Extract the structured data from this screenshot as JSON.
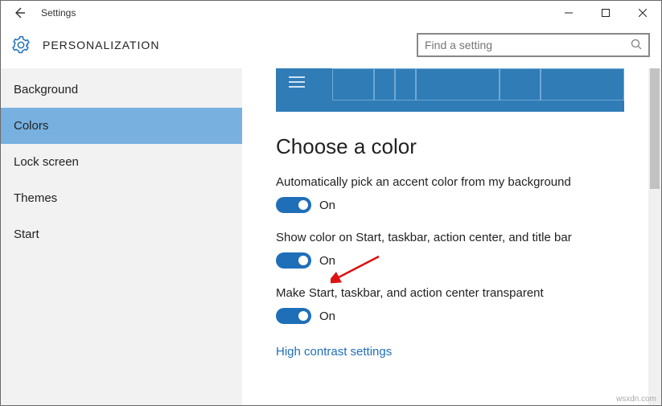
{
  "window": {
    "title": "Settings"
  },
  "header": {
    "title": "PERSONALIZATION",
    "search_placeholder": "Find a setting"
  },
  "sidebar": {
    "items": [
      {
        "label": "Background"
      },
      {
        "label": "Colors"
      },
      {
        "label": "Lock screen"
      },
      {
        "label": "Themes"
      },
      {
        "label": "Start"
      }
    ],
    "selected_index": 1
  },
  "content": {
    "heading": "Choose a color",
    "settings": [
      {
        "label": "Automatically pick an accent color from my background",
        "state": "On"
      },
      {
        "label": "Show color on Start, taskbar, action center, and title bar",
        "state": "On"
      },
      {
        "label": "Make Start, taskbar, and action center transparent",
        "state": "On"
      }
    ],
    "link": "High contrast settings"
  },
  "watermark": "wsxdn.com"
}
